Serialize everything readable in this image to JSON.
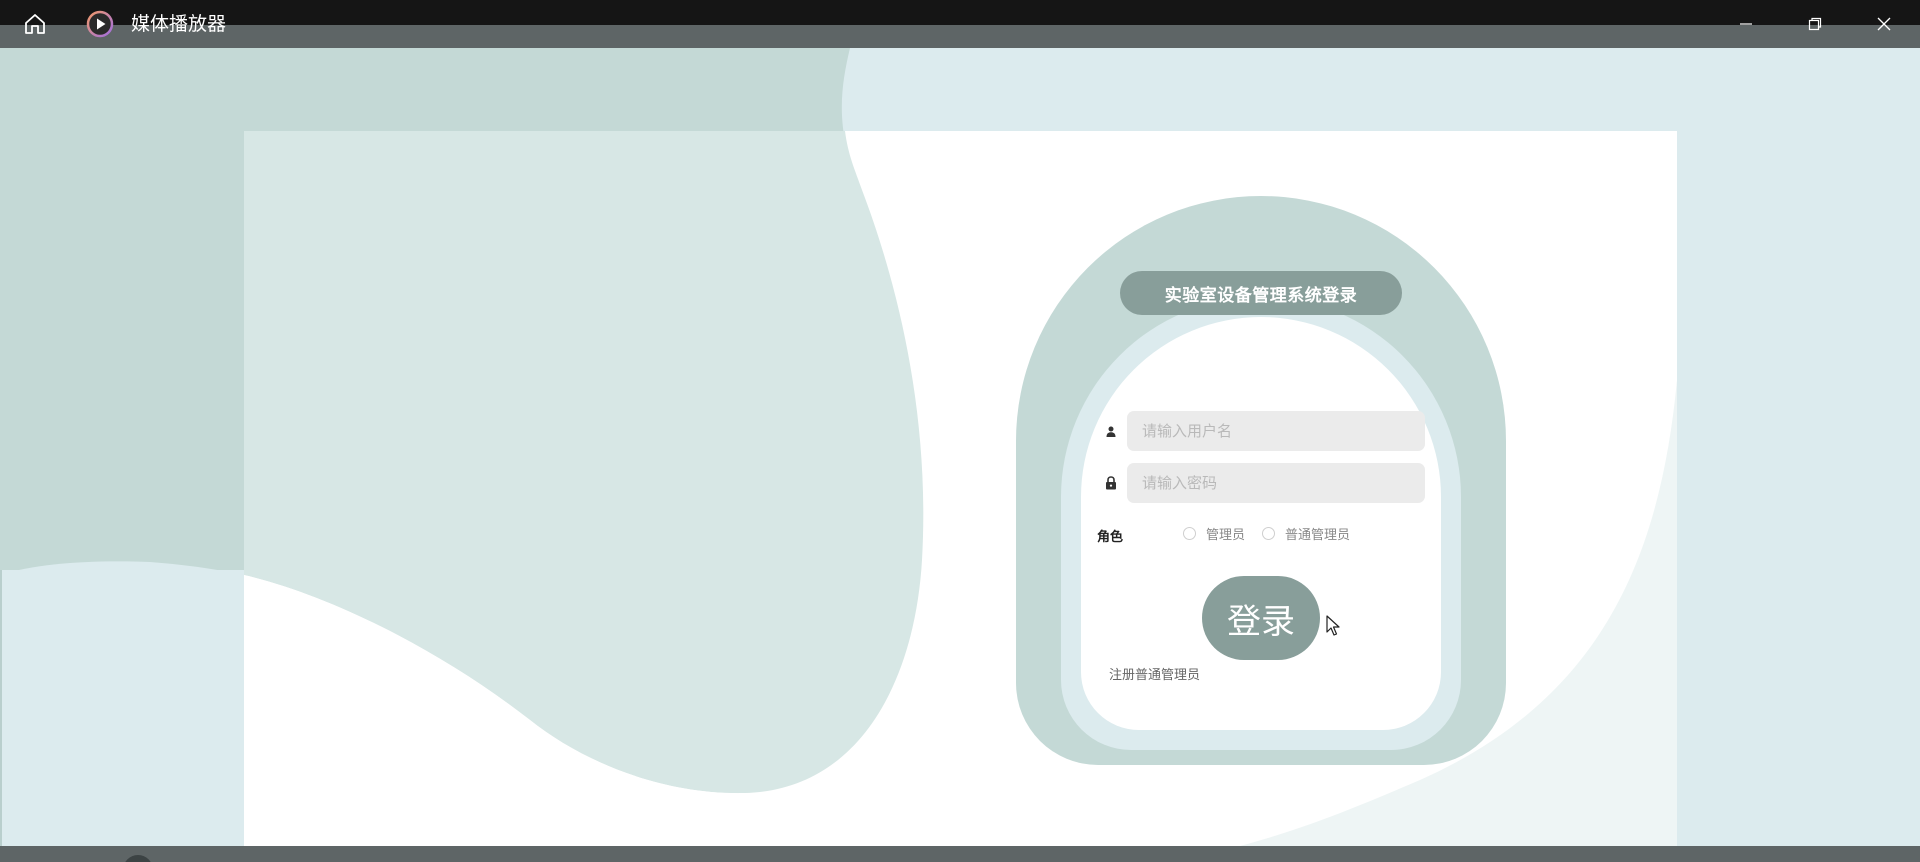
{
  "window": {
    "title": "媒体播放器"
  },
  "login": {
    "title": "实验室设备管理系统登录",
    "username_placeholder": "请输入用户名",
    "password_placeholder": "请输入密码",
    "role_label": "角色",
    "role_options": [
      "管理员",
      "普通管理员"
    ],
    "login_button": "登录",
    "register_link": "注册普通管理员"
  },
  "colors": {
    "titlebar": "#151515",
    "accent": "#889e9a",
    "card_outer": "#c4d9d6",
    "card_middle": "#dcebee",
    "input_bg": "#ebebeb"
  },
  "icons": {
    "home": "home-icon",
    "app": "play-icon",
    "minimize": "minimize-icon",
    "restore": "restore-icon",
    "close": "close-icon",
    "user": "user-icon",
    "lock": "lock-icon",
    "cursor": "mouse-cursor-icon"
  }
}
